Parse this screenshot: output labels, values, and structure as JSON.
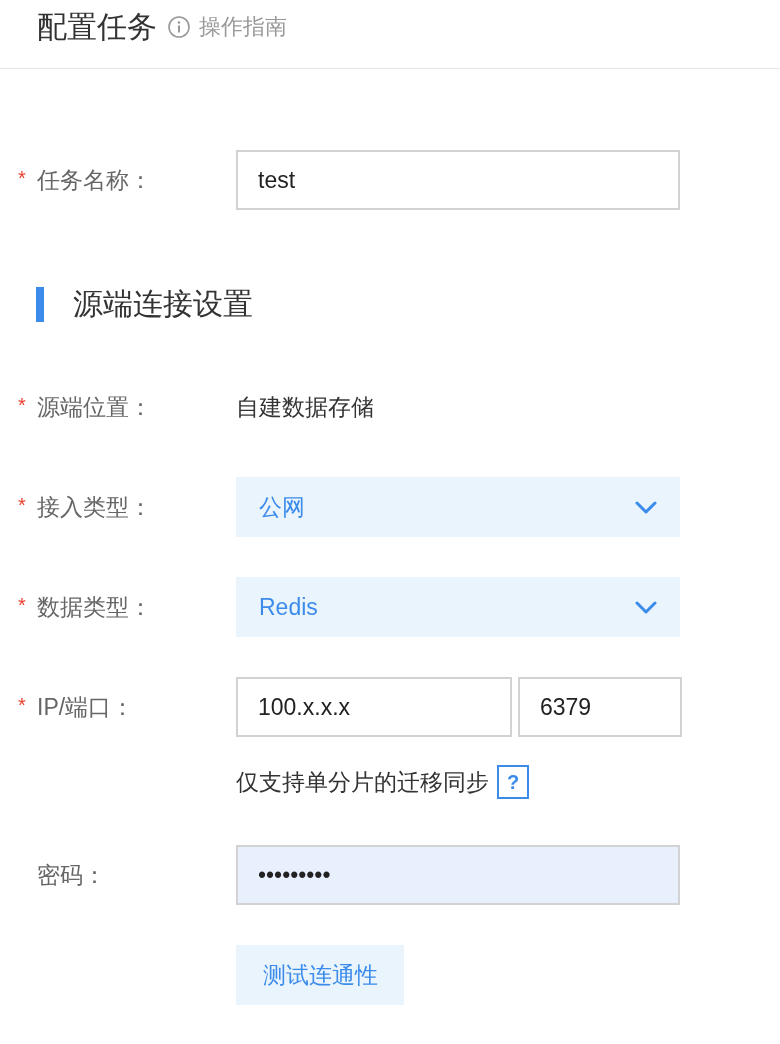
{
  "header": {
    "title": "配置任务",
    "guide_link": "操作指南"
  },
  "required_mark": "*",
  "task_fields": [
    {
      "kind": "input",
      "label": "任务名称：",
      "required": true,
      "value": "test"
    }
  ],
  "section": {
    "title": "源端连接设置"
  },
  "source_fields": [
    {
      "kind": "text",
      "label": "源端位置：",
      "required": true,
      "value": "自建数据存储"
    },
    {
      "kind": "select",
      "label": "接入类型：",
      "required": true,
      "value": "公网"
    },
    {
      "kind": "select",
      "label": "数据类型：",
      "required": true,
      "value": "Redis"
    },
    {
      "kind": "pair",
      "label": "IP/端口：",
      "required": true,
      "ip": "100.x.x.x",
      "port": "6379",
      "hint": "仅支持单分片的迁移同步",
      "help": "?"
    },
    {
      "kind": "password",
      "label": "密码：",
      "required": false,
      "value": "•••••••••"
    }
  ],
  "test_button": {
    "label": "测试连通性"
  }
}
